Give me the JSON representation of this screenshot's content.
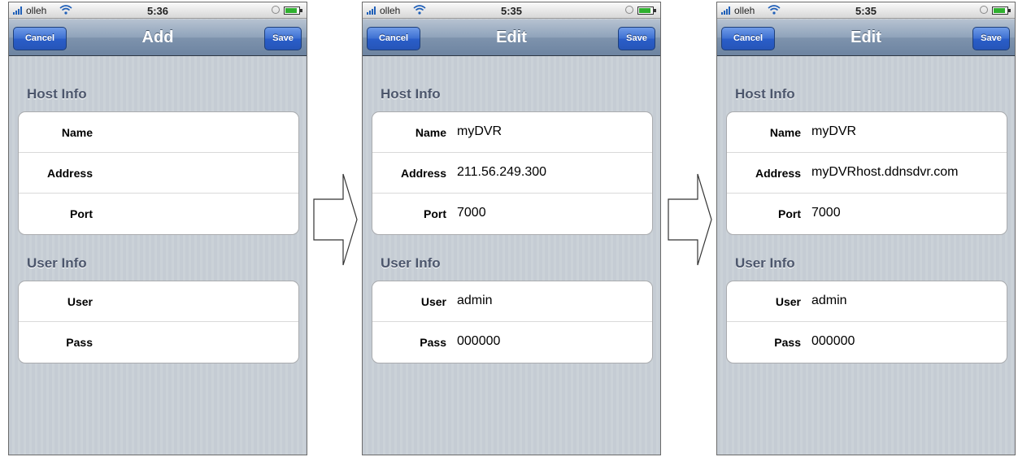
{
  "status": {
    "carrier": "olleh"
  },
  "screens": [
    {
      "time": "5:36",
      "title": "Add",
      "cancel_label": "Cancel",
      "save_label": "Save",
      "host_section": "Host Info",
      "user_section": "User Info",
      "fields": {
        "name": {
          "label": "Name",
          "value": ""
        },
        "address": {
          "label": "Address",
          "value": ""
        },
        "port": {
          "label": "Port",
          "value": ""
        },
        "user": {
          "label": "User",
          "value": ""
        },
        "pass": {
          "label": "Pass",
          "value": ""
        }
      }
    },
    {
      "time": "5:35",
      "title": "Edit",
      "cancel_label": "Cancel",
      "save_label": "Save",
      "host_section": "Host Info",
      "user_section": "User Info",
      "fields": {
        "name": {
          "label": "Name",
          "value": "myDVR"
        },
        "address": {
          "label": "Address",
          "value": "211.56.249.300"
        },
        "port": {
          "label": "Port",
          "value": "7000"
        },
        "user": {
          "label": "User",
          "value": "admin"
        },
        "pass": {
          "label": "Pass",
          "value": "000000"
        }
      }
    },
    {
      "time": "5:35",
      "title": "Edit",
      "cancel_label": "Cancel",
      "save_label": "Save",
      "host_section": "Host Info",
      "user_section": "User Info",
      "fields": {
        "name": {
          "label": "Name",
          "value": "myDVR"
        },
        "address": {
          "label": "Address",
          "value": "myDVRhost.ddnsdvr.com"
        },
        "port": {
          "label": "Port",
          "value": "7000"
        },
        "user": {
          "label": "User",
          "value": "admin"
        },
        "pass": {
          "label": "Pass",
          "value": "000000"
        }
      }
    }
  ],
  "icons": {
    "signal": "signal-bars-icon",
    "wifi": "wifi-icon",
    "alarm": "alarm-icon",
    "battery": "battery-icon",
    "arrow": "right-arrow-icon"
  },
  "colors": {
    "nav_bar": "#7e93ad",
    "nav_button": "#3d6fd1",
    "section_header": "#4c566c",
    "background": "#c5ccd4"
  }
}
